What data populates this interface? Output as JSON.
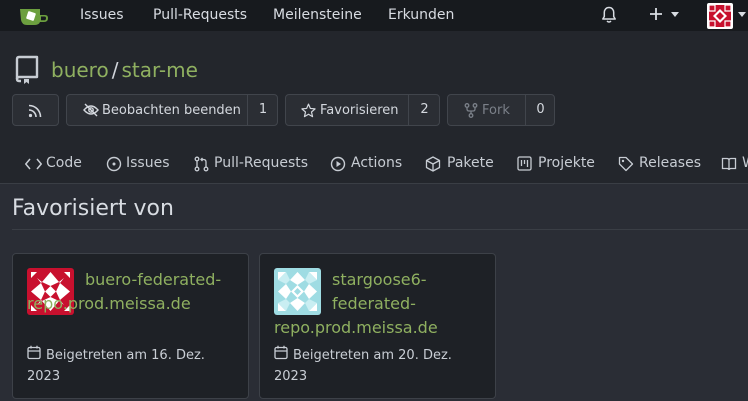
{
  "nav": {
    "items": [
      "Issues",
      "Pull-Requests",
      "Meilensteine",
      "Erkunden"
    ],
    "brand_color": "#6c9f3f"
  },
  "repo": {
    "owner": "buero",
    "separator": "/",
    "name": "star-me",
    "link_color": "#8fb060"
  },
  "actions": {
    "watch_label": "Beobachten beenden",
    "watch_count": "1",
    "star_label": "Favorisieren",
    "star_count": "2",
    "fork_label": "Fork",
    "fork_count": "0"
  },
  "tabs": [
    {
      "label": "Code",
      "icon": "code-icon"
    },
    {
      "label": "Issues",
      "icon": "issue-icon"
    },
    {
      "label": "Pull-Requests",
      "icon": "pull-request-icon"
    },
    {
      "label": "Actions",
      "icon": "play-icon"
    },
    {
      "label": "Pakete",
      "icon": "package-icon"
    },
    {
      "label": "Projekte",
      "icon": "project-icon"
    },
    {
      "label": "Releases",
      "icon": "tag-icon"
    },
    {
      "label": "W",
      "icon": "book-icon"
    }
  ],
  "page": {
    "heading": "Favorisiert von"
  },
  "stargazers": [
    {
      "name_first": "buero-federated-",
      "name_rest": "repo.prod.meissa.de",
      "joined_first": "Beigetreten am 16. Dez.",
      "joined_rest": "2023",
      "avatar_color": "#c8102e"
    },
    {
      "name_first": "stargoose6-",
      "name_mid": "federated-",
      "name_rest": "repo.prod.meissa.de",
      "joined_first": "Beigetreten am 20. Dez.",
      "joined_rest": "2023",
      "avatar_color": "#8fd3dc"
    }
  ]
}
